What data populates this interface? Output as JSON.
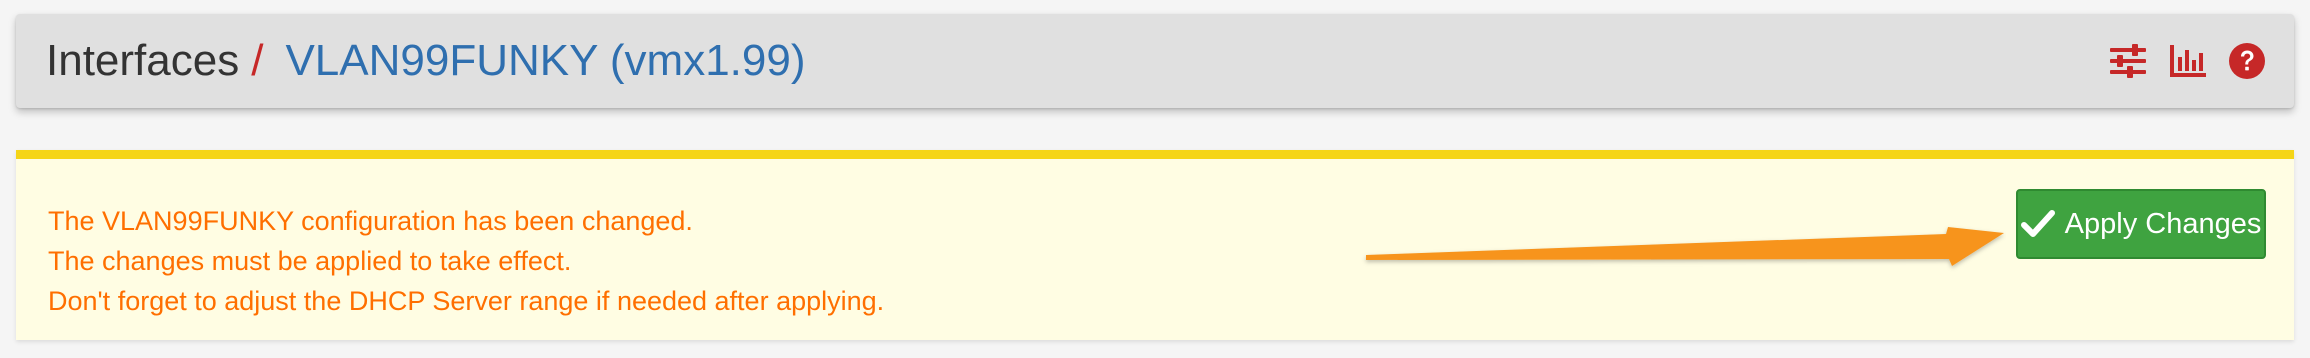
{
  "header": {
    "section": "Interfaces",
    "separator": "/",
    "current": "VLAN99FUNKY (vmx1.99)",
    "icons": [
      "sliders-icon",
      "bar-chart-icon",
      "help-circle-icon"
    ]
  },
  "alert": {
    "lines": [
      "The VLAN99FUNKY configuration has been changed.",
      "The changes must be applied to take effect.",
      "Don't forget to adjust the DHCP Server range if needed after applying."
    ],
    "apply_button_label": "Apply Changes",
    "apply_button_icon": "checkmark-icon",
    "annotation": "arrow-icon"
  },
  "colors": {
    "page_bg": "#f5f5f5",
    "header_bg": "#e0e0e0",
    "link_blue": "#2f6faf",
    "icon_red": "#c62828",
    "alert_bg": "#fffde3",
    "alert_border": "#f5d517",
    "alert_text": "#ff6f00",
    "button_green": "#3fa340",
    "arrow_orange": "#f7941d"
  }
}
